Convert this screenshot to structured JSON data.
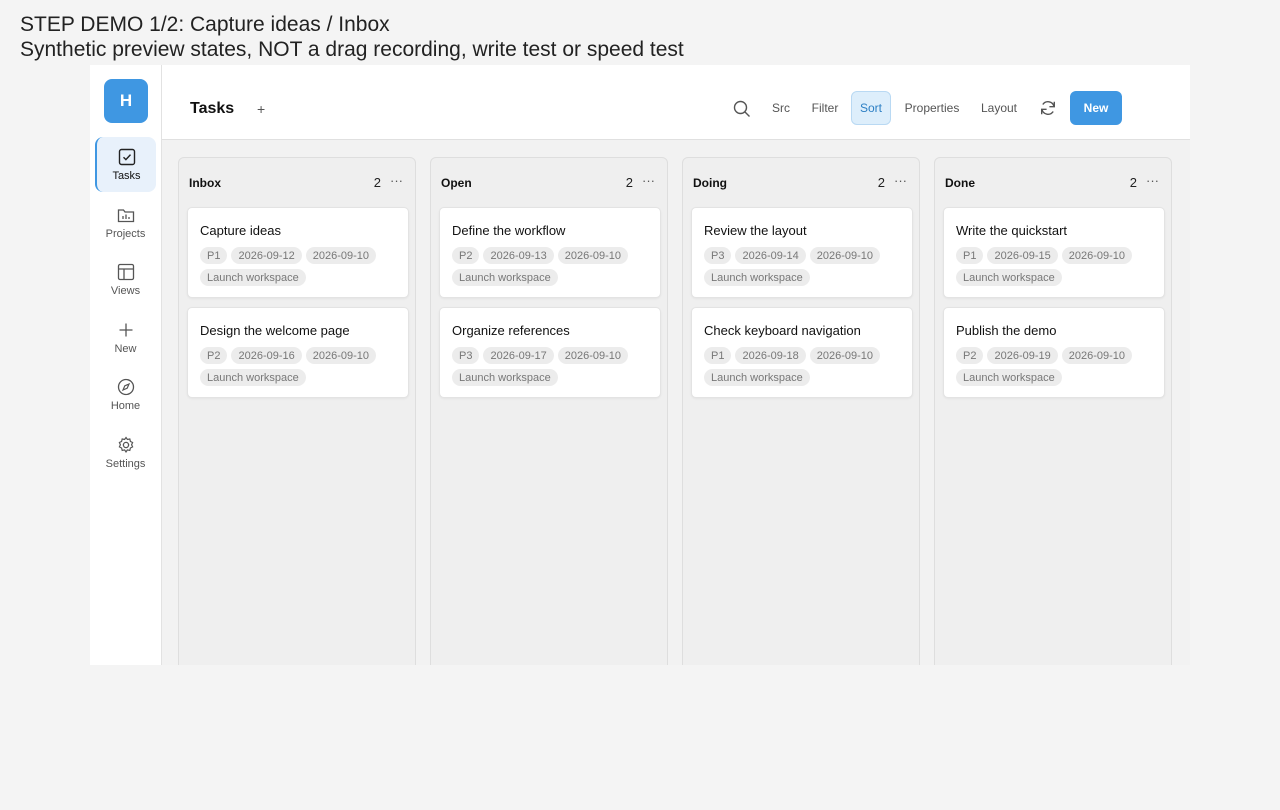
{
  "caption": {
    "line1": "STEP DEMO 1/2: Capture ideas / Inbox",
    "line2": "Synthetic preview states, NOT a drag recording, write test or speed test"
  },
  "sidebar": {
    "avatar": "H",
    "items": [
      {
        "label": "Tasks",
        "icon": "checkbox-icon",
        "active": true
      },
      {
        "label": "Projects",
        "icon": "folder-chart-icon"
      },
      {
        "label": "Views",
        "icon": "layout-icon"
      },
      {
        "label": "New",
        "icon": "plus-icon"
      },
      {
        "label": "Home",
        "icon": "compass-icon"
      },
      {
        "label": "Settings",
        "icon": "gear-icon"
      }
    ]
  },
  "header": {
    "title": "Tasks",
    "add_view": "+",
    "toolbar": {
      "src": "Src",
      "filter": "Filter",
      "sort": "Sort",
      "properties": "Properties",
      "layout": "Layout",
      "new": "New"
    }
  },
  "board": {
    "columns": [
      {
        "title": "Inbox",
        "count": "2",
        "more": "···",
        "cards": [
          {
            "title": "Capture ideas",
            "priority": "P1",
            "due": "2026-09-12",
            "created": "2026-09-10",
            "project": "Launch workspace"
          },
          {
            "title": "Design the welcome page",
            "priority": "P2",
            "due": "2026-09-16",
            "created": "2026-09-10",
            "project": "Launch workspace"
          }
        ]
      },
      {
        "title": "Open",
        "count": "2",
        "more": "···",
        "cards": [
          {
            "title": "Define the workflow",
            "priority": "P2",
            "due": "2026-09-13",
            "created": "2026-09-10",
            "project": "Launch workspace"
          },
          {
            "title": "Organize references",
            "priority": "P3",
            "due": "2026-09-17",
            "created": "2026-09-10",
            "project": "Launch workspace"
          }
        ]
      },
      {
        "title": "Doing",
        "count": "2",
        "more": "···",
        "cards": [
          {
            "title": "Review the layout",
            "priority": "P3",
            "due": "2026-09-14",
            "created": "2026-09-10",
            "project": "Launch workspace"
          },
          {
            "title": "Check keyboard navigation",
            "priority": "P1",
            "due": "2026-09-18",
            "created": "2026-09-10",
            "project": "Launch workspace"
          }
        ]
      },
      {
        "title": "Done",
        "count": "2",
        "more": "···",
        "cards": [
          {
            "title": "Write the quickstart",
            "priority": "P1",
            "due": "2026-09-15",
            "created": "2026-09-10",
            "project": "Launch workspace"
          },
          {
            "title": "Publish the demo",
            "priority": "P2",
            "due": "2026-09-19",
            "created": "2026-09-10",
            "project": "Launch workspace"
          }
        ]
      }
    ]
  },
  "colors": {
    "accent": "#3f97e2",
    "accent_light": "#ddeefb"
  }
}
